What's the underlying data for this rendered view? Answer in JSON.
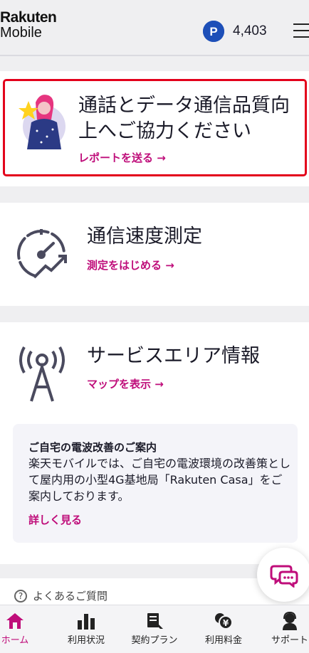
{
  "header": {
    "logo_line1": "Rakuten",
    "logo_line2": "Mobile",
    "points_value": "4,403"
  },
  "survey_card": {
    "title_line1": "通話とデータ通信品質向",
    "title_line2": "上へご協力ください",
    "link": "レポートを送る →"
  },
  "speed_card": {
    "title": "通信速度測定",
    "link": "測定をはじめる →"
  },
  "area_card": {
    "title": "サービスエリア情報",
    "link": "マップを表示 →",
    "info_title": "ご自宅の電波改善のご案内",
    "info_body": "楽天モバイルでは、ご自宅の電波環境の改善策として屋内用の小型4G基地局「Rakuten Casa」をご案内しております。",
    "info_link": "詳しく見る"
  },
  "faq": {
    "label": "よくあるご質問"
  },
  "bottom_nav": [
    {
      "label": "ホーム",
      "icon": "home-icon",
      "active": true
    },
    {
      "label": "利用状況",
      "icon": "bar-chart-icon"
    },
    {
      "label": "契約プラン",
      "icon": "contract-icon"
    },
    {
      "label": "利用料金",
      "icon": "yen-coins-icon"
    },
    {
      "label": "サポート",
      "icon": "support-icon"
    }
  ],
  "colors": {
    "accent": "#bf0d7a",
    "highlight_border": "#e3001b",
    "points_badge": "#1d4fb8"
  }
}
